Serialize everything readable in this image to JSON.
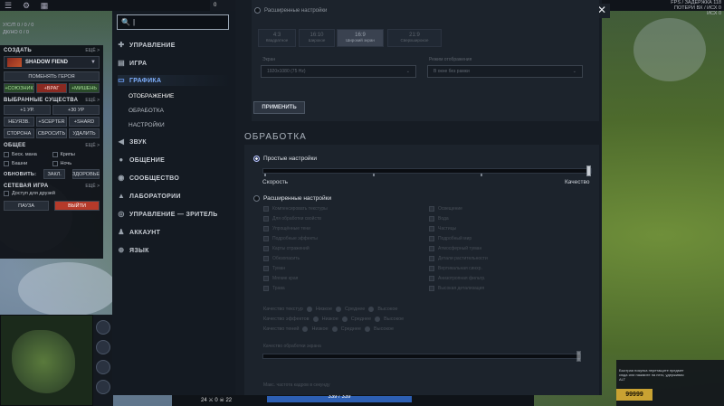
{
  "top": {
    "score_left": "0",
    "score_right": "0",
    "net": {
      "line1": "FPS / ЗАДЕРЖКА 118",
      "line2": "ПОТЕРИ ВХ / ИСХ 0",
      "line3": "ИСХ 0"
    }
  },
  "debug": {
    "stats": [
      "У/С/П 0 / 0 / 0",
      "ДК/НО 0 / 0"
    ],
    "create_label": "СОЗДАТЬ",
    "more": "ЕЩЁ >",
    "hero_name": "SHADOW FIEND",
    "replace_hero": "ПОМЕНЯТЬ ГЕРОЯ",
    "ally": "+СОЮЗНИК",
    "enemy": "+ВРАГ",
    "dummy": "+МИШЕНЬ",
    "selected_label": "ВЫБРАННЫЕ СУЩЕСТВА",
    "more2": "ЕЩЁ >",
    "lvl": "+1 УР.",
    "lvl30": "+30 УР",
    "invuln": "НЕУЯЗВ.",
    "scepter": "+SCEPTER",
    "shard": "+SHARD",
    "team": "СТОРОНА",
    "reset": "СБРОСИТЬ",
    "remove": "УДАЛИТЬ",
    "general_label": "ОБЩЕЕ",
    "more3": "ЕЩЁ >",
    "free_mana": "Беск. мана",
    "creeps": "Крипы",
    "towers": "Башни",
    "night": "Ночь",
    "refresh_label": "ОБНОВИТЬ:",
    "cd": "ЗАКЛ.",
    "health": "ЗДОРОВЬЕ",
    "network_label": "СЕТЕВАЯ ИГРА",
    "more4": "ЕЩЁ >",
    "friends": "Доступ для друзей",
    "pause": "ПАУЗА",
    "quit": "ВЫЙТИ"
  },
  "hud": {
    "kills": "24",
    "deaths": "0",
    "assists": "22",
    "mana": "339 / 339",
    "gold": "99999",
    "shop_tip": "Быстрая покупка перетащите предмет сюда или нажмите на него, удерживая ALT"
  },
  "settings": {
    "search_placeholder": "",
    "nav": [
      {
        "label": "УПРАВЛЕНИЕ",
        "icon": "gamepad-icon"
      },
      {
        "label": "ИГРА",
        "icon": "game-icon"
      },
      {
        "label": "ГРАФИКА",
        "icon": "monitor-icon"
      },
      {
        "label": "ЗВУК",
        "icon": "speaker-icon"
      },
      {
        "label": "ОБЩЕНИЕ",
        "icon": "chat-icon"
      },
      {
        "label": "СООБЩЕСТВО",
        "icon": "community-icon"
      },
      {
        "label": "ЛАБОРАТОРИИ",
        "icon": "flask-icon"
      },
      {
        "label": "УПРАВЛЕНИЕ — ЗРИТЕЛЬ",
        "icon": "spectator-icon"
      },
      {
        "label": "АККАУНТ",
        "icon": "account-icon"
      },
      {
        "label": "ЯЗЫК",
        "icon": "globe-icon"
      }
    ],
    "subnav": [
      "ОТОБРАЖЕНИЕ",
      "ОБРАБОТКА",
      "НАСТРОЙКИ"
    ],
    "advanced_top": "Расширенные настройки",
    "presets": [
      {
        "ratio": "4:3",
        "label": "Квадратное"
      },
      {
        "ratio": "16:10",
        "label": "Широкое"
      },
      {
        "ratio": "16:9",
        "label": "Широкий экран"
      },
      {
        "ratio": "21:9",
        "label": "Сверхширокое"
      }
    ],
    "resolution_label": "Экран",
    "resolution_value": "1920x1080 (75 Hz)",
    "mode_label": "Режим отображения",
    "mode_value": "В окне без рамки",
    "apply": "ПРИМЕНИТЬ",
    "section": "ОБРАБОТКА",
    "simple": "Простые настройки",
    "speed": "Скорость",
    "quality": "Качество",
    "advanced": "Расширенные настройки",
    "adv_left": [
      "Компенсировать текстуры",
      "Для обработки свойств",
      "Упрощённые тени",
      "Подробные эффекты",
      "Карты отражений",
      "Обезопасить",
      "Туман",
      "Мягкие края",
      "Трава"
    ],
    "adv_right": [
      "Освещение",
      "Вода",
      "Частицы",
      "Подробный мир",
      "Атмосферный туман",
      "Детали растительности",
      "Вертикальная синхр.",
      "Анизотропная фильтр.",
      "Высокая детализация"
    ],
    "q_textures": "Качество текстур",
    "q_effects": "Качество эффектов",
    "q_shadows": "Качество теней",
    "q_opts": [
      "Низкое",
      "Среднее",
      "Высокое"
    ],
    "render_label": "Качество обработки экрана",
    "fps_label": "Макс. частота кадров в секунду"
  }
}
